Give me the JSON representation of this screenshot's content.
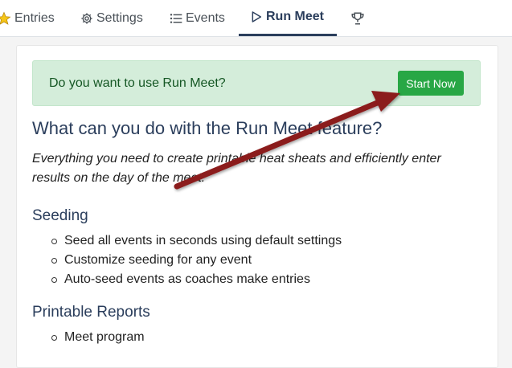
{
  "nav": {
    "tabs": [
      {
        "label": "Entries",
        "icon": "star-icon"
      },
      {
        "label": "Settings",
        "icon": "gear-icon"
      },
      {
        "label": "Events",
        "icon": "list-icon"
      },
      {
        "label": "Run Meet",
        "icon": "play-icon",
        "active": true
      },
      {
        "label": "",
        "icon": "trophy-icon"
      }
    ]
  },
  "alert": {
    "question": "Do you want to use Run Meet?",
    "button_label": "Start Now"
  },
  "main": {
    "heading": "What can you do with the Run Meet feature?",
    "lead": "Everything you need to create printable heat sheats and efficiently enter results on the day of the meet.",
    "sections": [
      {
        "title": "Seeding",
        "items": [
          "Seed all events in seconds using default settings",
          "Customize seeding for any event",
          "Auto-seed events as coaches make entries"
        ]
      },
      {
        "title": "Printable Reports",
        "items": [
          "Meet program"
        ]
      }
    ]
  },
  "colors": {
    "accent": "#2b3e5c",
    "alert_bg": "#d4edda",
    "button_green": "#28a745",
    "annotation_arrow": "#8b1a1a"
  }
}
